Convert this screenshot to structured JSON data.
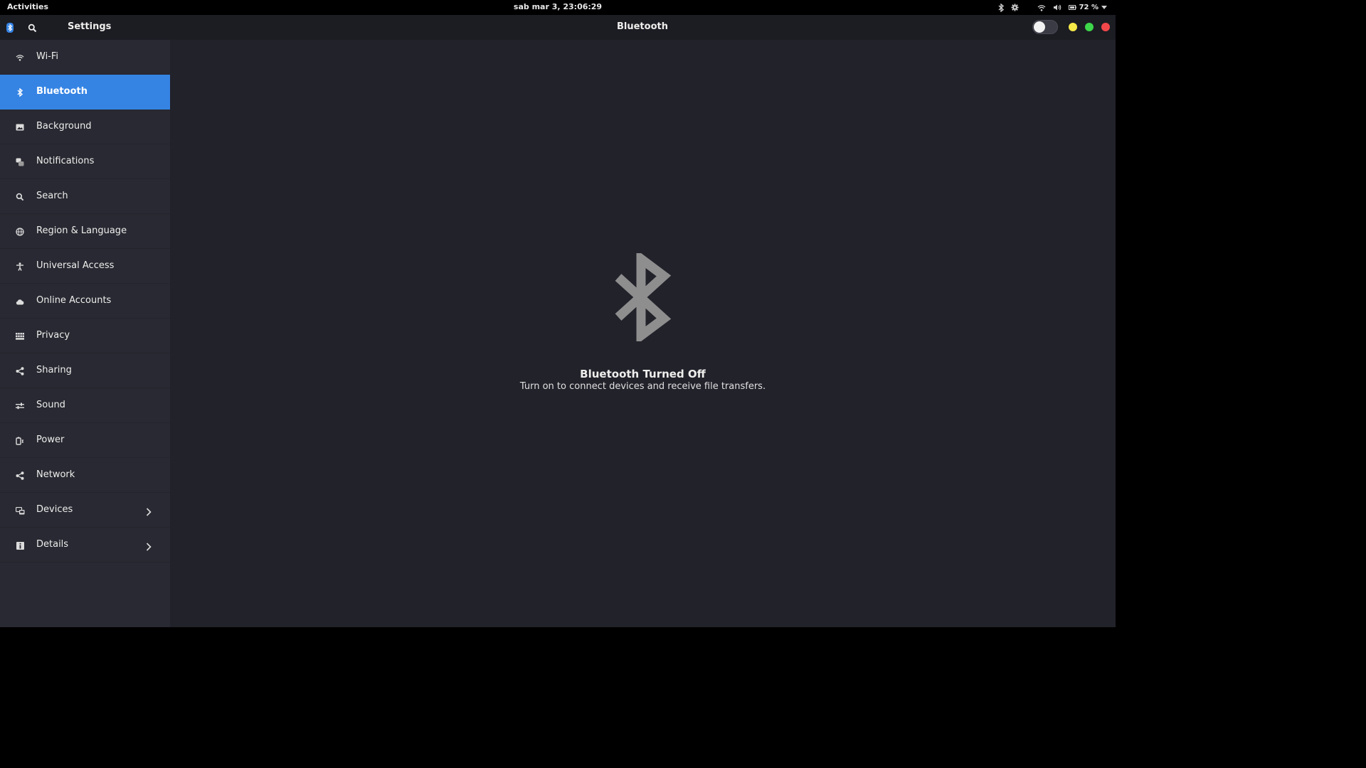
{
  "top_panel": {
    "activities": "Activities",
    "clock": "sab mar  3, 23:06:29",
    "battery": "72 %",
    "tray_icons": [
      "bluetooth-icon",
      "settings-icon",
      "wifi-icon",
      "volume-icon",
      "battery-icon",
      "chevron-down-icon"
    ]
  },
  "headerbar": {
    "app_title": "Settings",
    "page_title": "Bluetooth",
    "bluetooth_switch_on": false
  },
  "sidebar": {
    "items": [
      {
        "label": "Wi-Fi",
        "icon": "wifi-icon"
      },
      {
        "label": "Bluetooth",
        "icon": "bluetooth-icon",
        "active": true
      },
      {
        "label": "Background",
        "icon": "image-icon"
      },
      {
        "label": "Notifications",
        "icon": "notifications-icon"
      },
      {
        "label": "Search",
        "icon": "search-icon"
      },
      {
        "label": "Region & Language",
        "icon": "globe-icon"
      },
      {
        "label": "Universal Access",
        "icon": "accessibility-icon"
      },
      {
        "label": "Online Accounts",
        "icon": "cloud-icon"
      },
      {
        "label": "Privacy",
        "icon": "privacy-icon"
      },
      {
        "label": "Sharing",
        "icon": "share-icon"
      },
      {
        "label": "Sound",
        "icon": "sound-icon"
      },
      {
        "label": "Power",
        "icon": "power-icon"
      },
      {
        "label": "Network",
        "icon": "network-icon"
      },
      {
        "label": "Devices",
        "icon": "devices-icon",
        "has_submenu": true
      },
      {
        "label": "Details",
        "icon": "info-icon",
        "has_submenu": true
      }
    ]
  },
  "main": {
    "status_title": "Bluetooth Turned Off",
    "status_subtitle": "Turn on to connect devices and receive file transfers."
  },
  "colors": {
    "accent": "#3584e4",
    "window_bg": "#22222b",
    "sidebar_bg": "#282932",
    "minimize": "#f5e948",
    "maximize": "#3ed64a",
    "close": "#f2474a"
  }
}
